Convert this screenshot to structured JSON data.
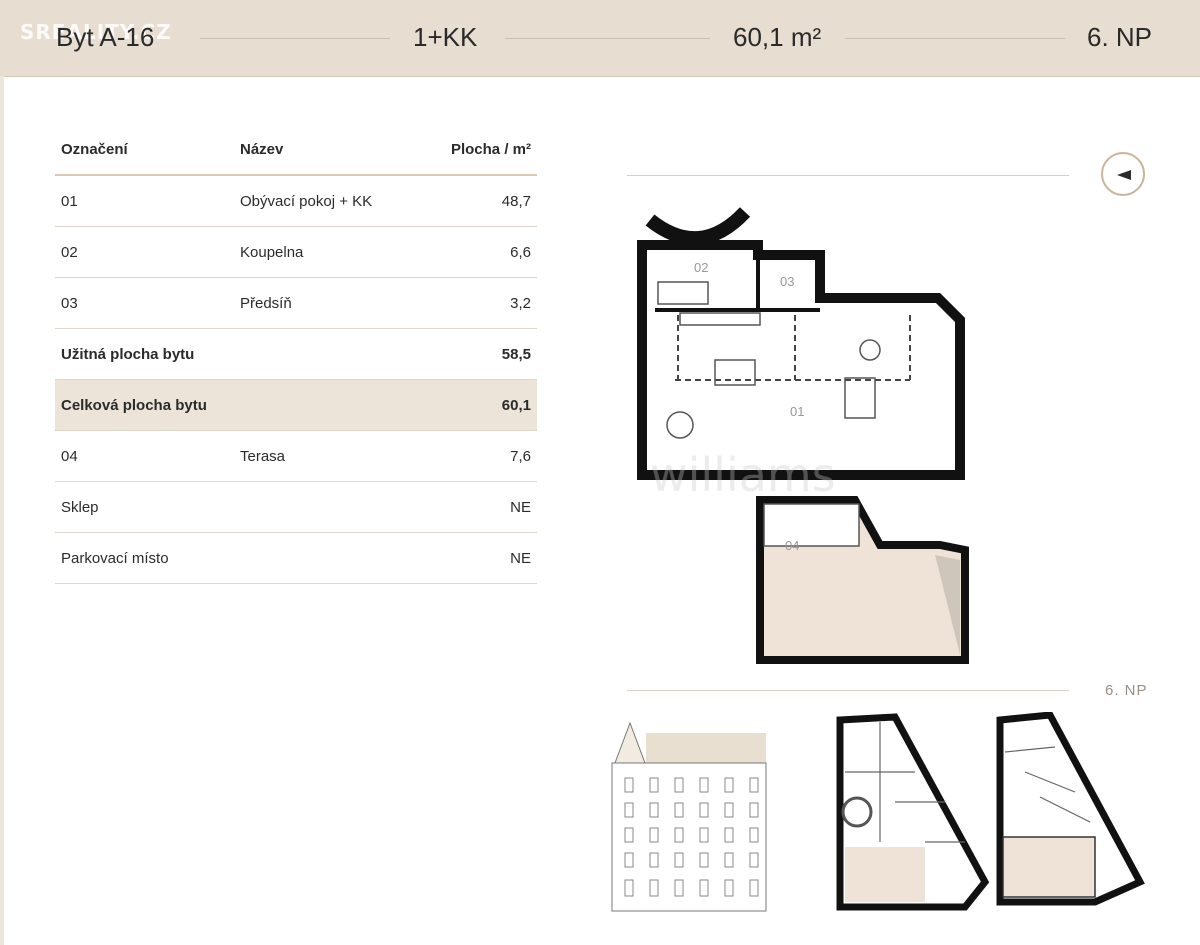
{
  "header": {
    "logo": "SREALITY.CZ",
    "unit": "Byt A-16",
    "layout": "1+KK",
    "area": "60,1 m²",
    "floor": "6. NP"
  },
  "table": {
    "headers": [
      "Označení",
      "Název",
      "Plocha / m²"
    ],
    "rows": [
      {
        "code": "01",
        "name": "Obývací pokoj + KK",
        "area": "48,7"
      },
      {
        "code": "02",
        "name": "Koupelna",
        "area": "6,6"
      },
      {
        "code": "03",
        "name": "Předsíň",
        "area": "3,2"
      },
      {
        "code": "Užitná plocha bytu",
        "name": "",
        "area": "58,5"
      },
      {
        "code": "Celková plocha bytu",
        "name": "",
        "area": "60,1"
      },
      {
        "code": "04",
        "name": "Terasa",
        "area": "7,6"
      },
      {
        "code": "Sklep",
        "name": "",
        "area": "NE"
      },
      {
        "code": "Parkovací místo",
        "name": "",
        "area": "NE"
      }
    ]
  },
  "plan": {
    "room_labels": [
      "01",
      "02",
      "03",
      "04"
    ],
    "floor_label": "6. NP",
    "watermark": "williams"
  },
  "colors": {
    "header_bg": "#e7ddd0",
    "highlight_row": "#ece4d8",
    "wall": "#111111",
    "room_fill": "#eee3d6"
  }
}
